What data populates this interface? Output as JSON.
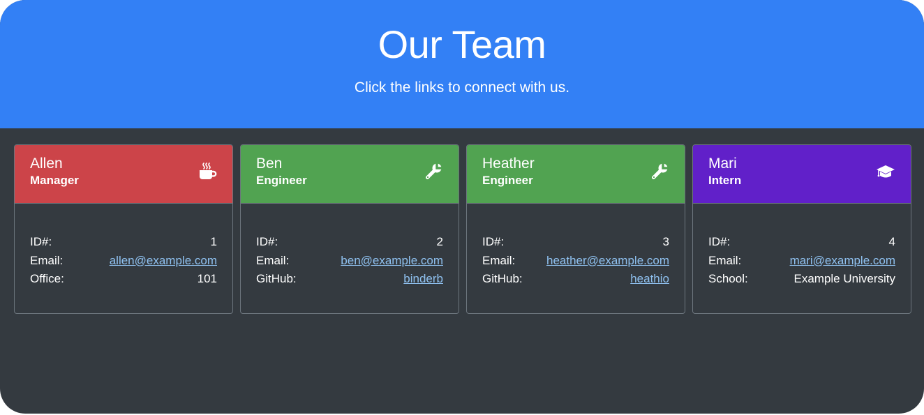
{
  "header": {
    "title": "Our Team",
    "subtitle": "Click the links to connect with us."
  },
  "colors": {
    "hero": "#3380f5",
    "background": "#343a40",
    "manager": "#cc4449",
    "engineer": "#51a351",
    "intern": "#6120c9",
    "link": "#8fc1f0"
  },
  "cards": [
    {
      "name": "Allen",
      "role": "Manager",
      "icon": "coffee-icon",
      "rows": [
        {
          "label": "ID#:",
          "value": "1"
        },
        {
          "label": "Email:",
          "value": "allen@example.com"
        },
        {
          "label": "Office:",
          "value": "101"
        }
      ]
    },
    {
      "name": "Ben",
      "role": "Engineer",
      "icon": "wrench-icon",
      "rows": [
        {
          "label": "ID#:",
          "value": "2"
        },
        {
          "label": "Email:",
          "value": "ben@example.com"
        },
        {
          "label": "GitHub:",
          "value": "binderb"
        }
      ]
    },
    {
      "name": "Heather",
      "role": "Engineer",
      "icon": "wrench-icon",
      "rows": [
        {
          "label": "ID#:",
          "value": "3"
        },
        {
          "label": "Email:",
          "value": "heather@example.com"
        },
        {
          "label": "GitHub:",
          "value": "heathio"
        }
      ]
    },
    {
      "name": "Mari",
      "role": "Intern",
      "icon": "graduation-cap-icon",
      "rows": [
        {
          "label": "ID#:",
          "value": "4"
        },
        {
          "label": "Email:",
          "value": "mari@example.com"
        },
        {
          "label": "School:",
          "value": "Example University"
        }
      ]
    }
  ]
}
